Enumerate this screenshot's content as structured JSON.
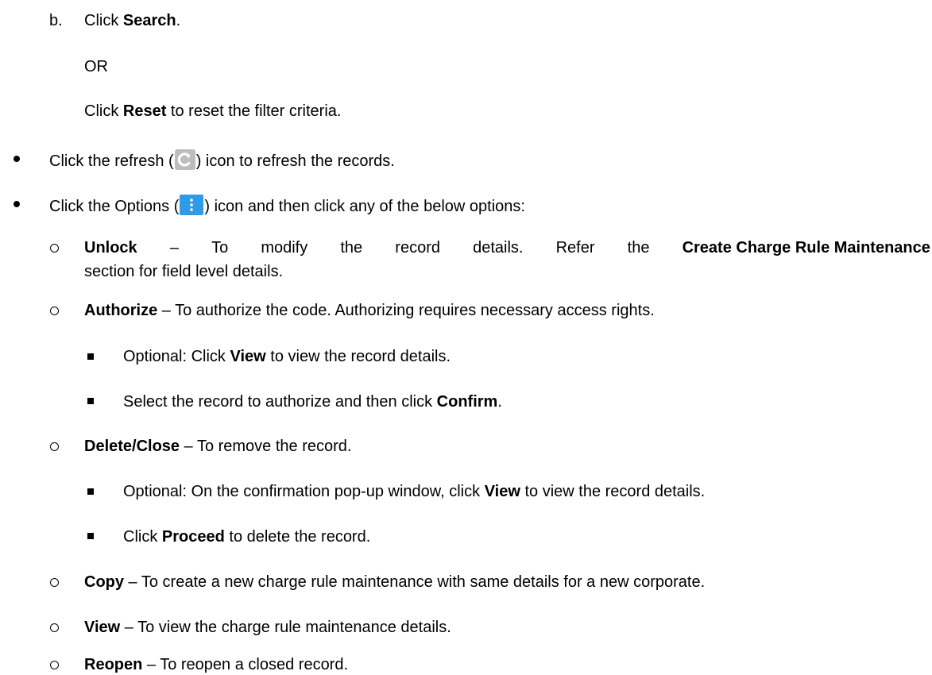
{
  "step_b": {
    "marker": "b.",
    "prefix": "Click ",
    "action": "Search",
    "suffix": "."
  },
  "or_text": "OR",
  "reset_line": {
    "prefix": "Click ",
    "action": "Reset",
    "suffix": " to reset the filter criteria."
  },
  "refresh_line": {
    "prefix": "Click the refresh (",
    "suffix": ") icon to refresh the records."
  },
  "options_line": {
    "prefix": "Click the Options (",
    "suffix": ") icon and then click any of the below options:"
  },
  "unlock": {
    "name": "Unlock",
    "line1_words": [
      "–",
      "To",
      "modify",
      "the",
      "record",
      "details.",
      "Refer",
      "the"
    ],
    "line1_bold_tail": "Create Charge Rule Maintenance",
    "line2": "section for field level details."
  },
  "authorize": {
    "name": "Authorize",
    "desc": " – To authorize the code. Authorizing requires necessary access rights.",
    "sub1": {
      "prefix": "Optional: Click ",
      "action": "View",
      "suffix": " to view the record details."
    },
    "sub2": {
      "prefix": "Select the record to authorize and then click ",
      "action": "Confirm",
      "suffix": "."
    }
  },
  "delete_close": {
    "name": "Delete/Close",
    "desc": " – To remove the record.",
    "sub1": {
      "prefix": "Optional: On the confirmation pop-up window, click ",
      "action": "View",
      "suffix": " to view the record details."
    },
    "sub2": {
      "prefix": "Click ",
      "action": "Proceed",
      "suffix": " to delete the record."
    }
  },
  "copy": {
    "name": "Copy",
    "desc": " – To create a new charge rule maintenance with same details for a new corporate."
  },
  "view": {
    "name": "View",
    "desc": " – To view the charge rule maintenance details."
  },
  "reopen": {
    "name": "Reopen",
    "desc": " – To reopen a closed record."
  },
  "icons": {
    "refresh": "refresh-icon",
    "options": "options-icon",
    "refresh_color": "#bdbdbd",
    "options_color": "#2f9be8"
  }
}
